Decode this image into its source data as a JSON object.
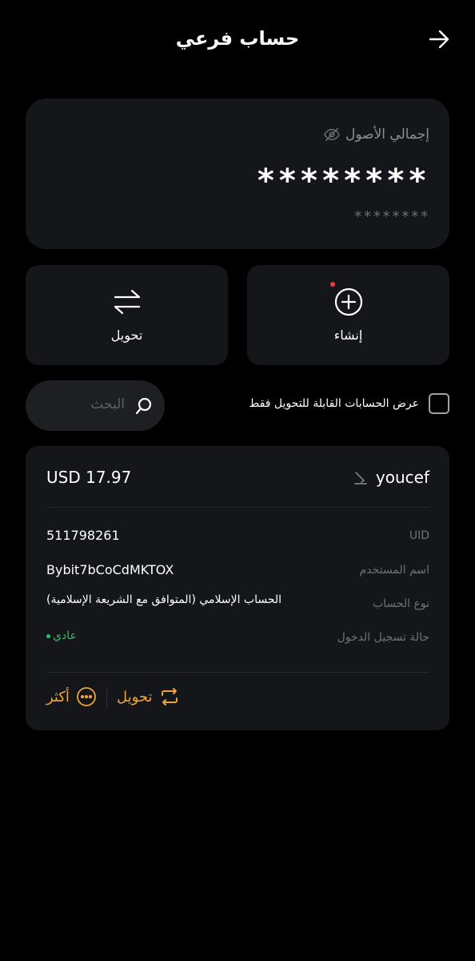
{
  "header": {
    "title": "حساب فرعي"
  },
  "assets": {
    "label": "إجمالي الأصول",
    "masked_value": "********",
    "masked_sub": "********"
  },
  "actions": {
    "create": "إنشاء",
    "transfer": "تحويل"
  },
  "filter": {
    "label": "عرض الحسابات القابلة للتحويل فقط",
    "checked": false
  },
  "search": {
    "placeholder": "البحث"
  },
  "account": {
    "name": "youcef",
    "balance": "USD 17.97",
    "rows": [
      {
        "label": "UID",
        "value": "511798261"
      },
      {
        "label": "اسم المستخدم",
        "value": "Bybit7bCoCdMKTOX"
      },
      {
        "label": "نوع الحساب",
        "value": "الحساب الإسلامي (المتوافق مع الشريعة الإسلامية)"
      },
      {
        "label": "حالة تسجيل الدخول",
        "value": "عادي"
      }
    ],
    "transfer_label": "تحويل",
    "more_label": "أكثر"
  },
  "colors": {
    "accent": "#f0a437",
    "status_ok": "#27c26c",
    "card_bg": "#141619",
    "notify_dot": "#ef3b3b"
  },
  "icons": [
    "arrow-right-icon",
    "eye-off-icon",
    "plus-circle-icon",
    "transfer-arrows-icon",
    "search-icon",
    "edit-icon",
    "swap-icon",
    "more-dots-icon"
  ]
}
